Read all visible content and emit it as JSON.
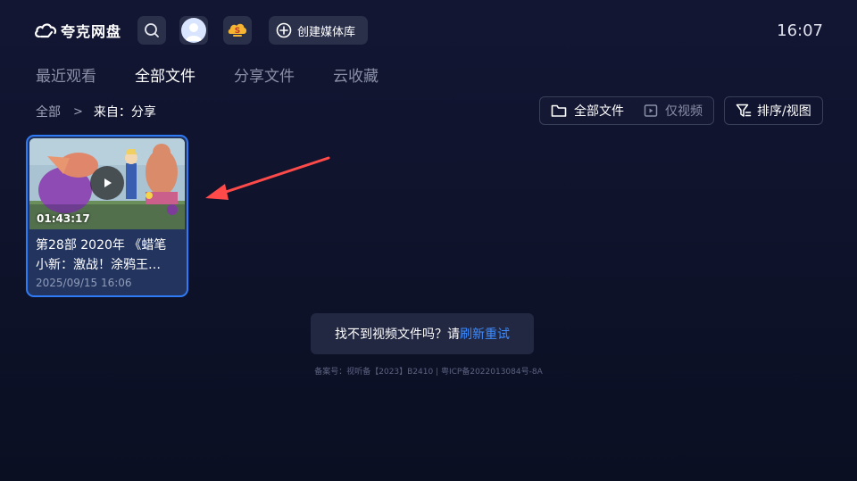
{
  "app": {
    "name": "夸克网盘",
    "clock": "16:07"
  },
  "header": {
    "create_label": "创建媒体库"
  },
  "tabs": [
    {
      "label": "最近观看",
      "active": false
    },
    {
      "label": "全部文件",
      "active": true
    },
    {
      "label": "分享文件",
      "active": false
    },
    {
      "label": "云收藏",
      "active": false
    }
  ],
  "breadcrumb": {
    "root": "全部",
    "separator": ">",
    "current": "来自：分享"
  },
  "filters": {
    "all_files": "全部文件",
    "video_only": "仅视频",
    "sort_view": "排序/视图"
  },
  "files": [
    {
      "title_line1": "第28部 2020年 《蜡笔",
      "title_line2": "小新：激战！涂鸦王…",
      "duration": "01:43:17",
      "date": "2025/09/15 16:06"
    }
  ],
  "notice": {
    "text": "找不到视频文件吗？请",
    "link": "刷新重试"
  },
  "footer": {
    "icp": "备案号：视听备【2023】B2410 | 粤ICP备2022013084号-8A"
  },
  "colors": {
    "accent": "#2f7bf5",
    "link": "#3d8bff",
    "annotation_arrow": "#ff4a4a"
  },
  "icons": [
    "cloud-logo-icon",
    "search-icon",
    "avatar-icon",
    "vip-badge-icon",
    "plus-circle-icon",
    "folder-icon",
    "video-icon",
    "sort-filter-icon",
    "chevron-right-icon",
    "play-icon"
  ]
}
